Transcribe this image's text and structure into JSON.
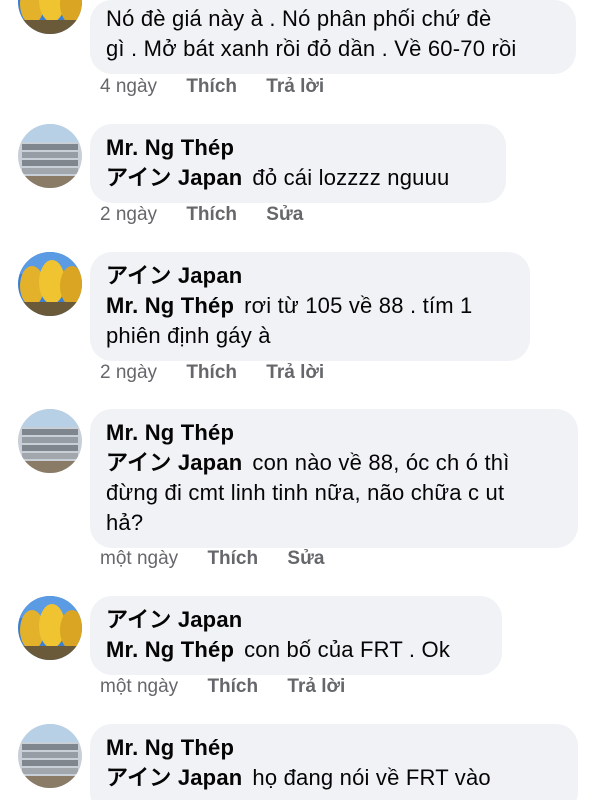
{
  "comments": [
    {
      "author": "",
      "mention": "",
      "text_lines": [
        "Nó đè giá này à . Nó phân phối chứ đè",
        "gì . Mở bát xanh rồi đỏ dần . Về 60-70 rồi"
      ],
      "time": "4 ngày",
      "like_label": "Thích",
      "action_label": "Trả lời",
      "avatar": "autumn-trees-avatar"
    },
    {
      "author": "Mr. Ng Thép",
      "mention": "アイン Japan",
      "text_lines": [
        "đỏ cái lozzzz nguuu"
      ],
      "time": "2 ngày",
      "like_label": "Thích",
      "action_label": "Sửa",
      "avatar": "steel-pipes-avatar"
    },
    {
      "author": "アイン Japan",
      "mention": "Mr. Ng Thép",
      "text_lines": [
        "rơi từ 105 về 88 . tím 1",
        "phiên định gáy à"
      ],
      "time": "2 ngày",
      "like_label": "Thích",
      "action_label": "Trả lời",
      "avatar": "autumn-trees-avatar"
    },
    {
      "author": "Mr. Ng Thép",
      "mention": "アイン Japan",
      "text_lines": [
        "con nào về 88, óc ch ó thì",
        "đừng đi cmt linh tinh nữa, não chữa c ut",
        "hả?"
      ],
      "time": "một ngày",
      "like_label": "Thích",
      "action_label": "Sửa",
      "avatar": "steel-pipes-avatar"
    },
    {
      "author": "アイン Japan",
      "mention": "Mr. Ng Thép",
      "text_lines": [
        "con bố của FRT . Ok"
      ],
      "time": "một ngày",
      "like_label": "Thích",
      "action_label": "Trả lời",
      "avatar": "autumn-trees-avatar"
    },
    {
      "author": "Mr. Ng Thép",
      "mention": "アイン Japan",
      "text_lines": [
        "họ đang nói về FRT vào"
      ],
      "time": "",
      "like_label": "",
      "action_label": "",
      "avatar": "steel-pipes-avatar"
    }
  ]
}
